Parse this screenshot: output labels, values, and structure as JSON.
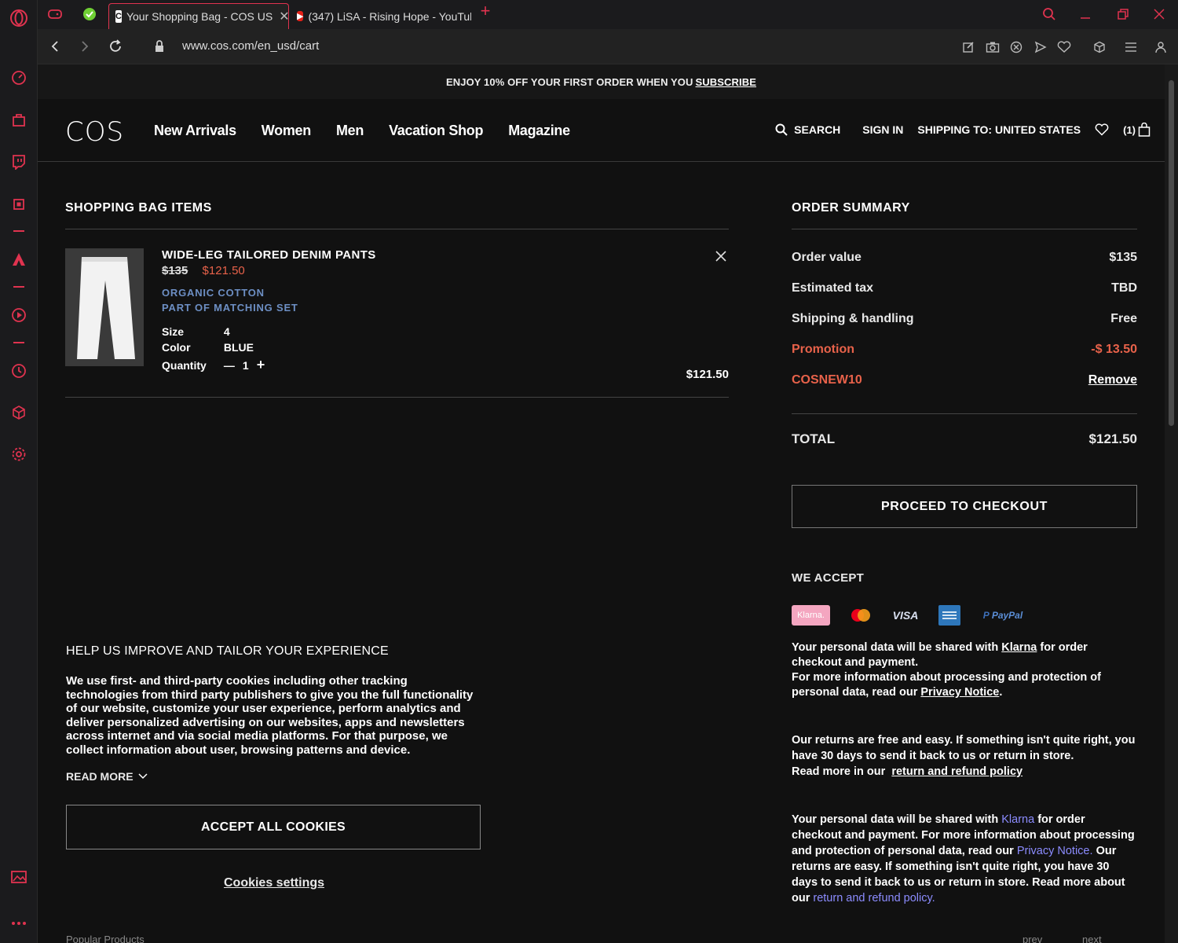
{
  "browser": {
    "tabs": [
      {
        "title": "Your Shopping Bag - COS US",
        "active": true
      },
      {
        "title": "(347) LiSA - Rising Hope - YouTube",
        "active": false
      }
    ],
    "new_tab_symbol": "+",
    "url": "www.cos.com/en_usd/cart",
    "accent_color": "#e0334f"
  },
  "site": {
    "promo_text": "ENJOY 10% OFF YOUR FIRST ORDER WHEN YOU",
    "promo_link": "SUBSCRIBE",
    "logo": "COS",
    "nav": [
      "New Arrivals",
      "Women",
      "Men",
      "Vacation Shop",
      "Magazine"
    ],
    "search_label": "SEARCH",
    "sign_in_label": "SIGN IN",
    "shipping_label": "SHIPPING TO: UNITED STATES",
    "bag_count": "(1)"
  },
  "bag": {
    "title": "SHOPPING BAG ITEMS",
    "item": {
      "name": "WIDE-LEG TAILORED DENIM PANTS",
      "old_price": "$135",
      "new_price": "$121.50",
      "tag1": "ORGANIC COTTON",
      "tag2": "PART OF MATCHING SET",
      "size_label": "Size",
      "size_value": "4",
      "color_label": "Color",
      "color_value": "BLUE",
      "quantity_label": "Quantity",
      "quantity_value": "1",
      "minus": "—",
      "plus": "+",
      "line_total": "$121.50"
    }
  },
  "summary": {
    "title": "ORDER SUMMARY",
    "rows": [
      {
        "label": "Order value",
        "value": "$135"
      },
      {
        "label": "Estimated tax",
        "value": "TBD"
      },
      {
        "label": "Shipping & handling",
        "value": "Free"
      },
      {
        "label": "Promotion",
        "value": "-$ 13.50"
      },
      {
        "label": "COSNEW10",
        "value": "Remove"
      }
    ],
    "total_label": "TOTAL",
    "total_value": "$121.50",
    "checkout_label": "PROCEED TO CHECKOUT",
    "accept_title": "WE ACCEPT",
    "payments": [
      "Klarna.",
      "VISA",
      "PayPal"
    ],
    "klarna_text_1": "Your personal data will be shared with",
    "klarna_link": "Klarna",
    "klarna_text_2": "for order checkout and payment.",
    "klarna_text_3": "For more information about processing and protection of personal data, read our",
    "privacy_link": "Privacy Notice",
    "returns_text_1": "Our returns are free and easy. If something isn't quite right, you have 30 days to send it back to us or return in store.",
    "returns_text_2": "Read more in our",
    "returns_link": "return and refund policy",
    "dup_1": "Your personal data will be shared with",
    "dup_klarna": "Klarna",
    "dup_2": "for order checkout and payment. For more information about processing and protection of personal data, read our",
    "dup_privacy": "Privacy Notice.",
    "dup_3": "Our returns are easy. If something isn't quite right, you have 30 days to send it back to us or return in store. Read more about our",
    "dup_returns": "return and refund policy."
  },
  "cookie": {
    "title": "HELP US IMPROVE AND TAILOR YOUR EXPERIENCE",
    "body": "We use first- and third-party cookies including other tracking technologies from third party publishers to give you the full functionality of our website, customize your user experience, perform analytics and deliver personalized advertising on our websites, apps and newsletters across internet and via social media platforms. For that purpose, we collect information about user, browsing patterns and device.",
    "read_more": "READ MORE",
    "accept": "ACCEPT ALL COOKIES",
    "settings": "Cookies settings"
  },
  "peek": {
    "left": "Popular Products",
    "prev": "prev",
    "next": "next"
  }
}
